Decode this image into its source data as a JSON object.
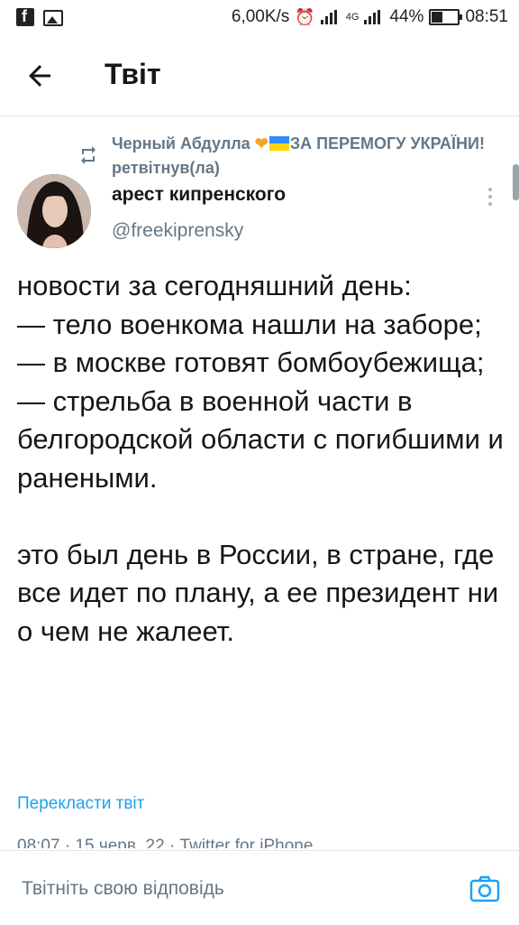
{
  "status_bar": {
    "speed": "6,00K/s",
    "network": "4G",
    "battery": "44%",
    "time": "08:51"
  },
  "header": {
    "title": "Твіт"
  },
  "tweet": {
    "retweeted_by_name": "Черный Абдулла",
    "retweeted_by_suffix": "ЗА ПЕРЕМОГУ УКРАЇНИ! ретвітнув(ла)",
    "author_name": "арест кипренского",
    "author_handle": "@freekiprensky",
    "text": "новости за сегодняшний день:\n— тело военкома нашли на заборе;\n— в москве готовят бомбоубежища;\n— стрельба в военной части в белгородской области с погибшими и ранеными.\n\nэто был день в России, в стране, где все идет по плану, а ее президент ни о чем не жалеет.",
    "translate_label": "Перекласти твіт",
    "meta": "08:07 · 15 черв. 22 · Twitter for iPhone"
  },
  "reply": {
    "placeholder": "Твітніть свою відповідь"
  },
  "colors": {
    "accent": "#1da1f2",
    "secondary_text": "#657786",
    "primary_text": "#14171a"
  }
}
